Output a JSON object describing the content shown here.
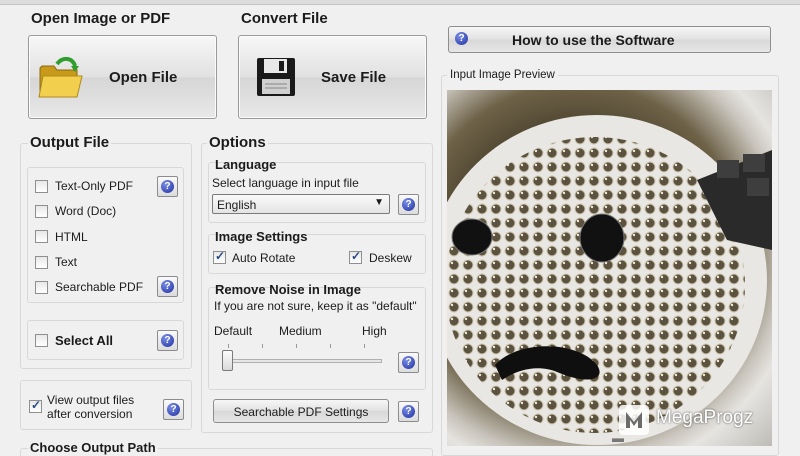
{
  "open_group": {
    "title": "Open Image or PDF",
    "button_label": "Open File"
  },
  "convert_group": {
    "title": "Convert File",
    "button_label": "Save File"
  },
  "how_to_button": {
    "label": "How to use the Software"
  },
  "preview": {
    "title": "Input Image Preview"
  },
  "output_file": {
    "title": "Output File",
    "options": [
      {
        "label": "Text-Only PDF",
        "checked": false
      },
      {
        "label": "Word (Doc)",
        "checked": false
      },
      {
        "label": "HTML",
        "checked": false
      },
      {
        "label": "Text",
        "checked": false
      },
      {
        "label": "Searchable PDF",
        "checked": false
      }
    ],
    "select_all": "Select All"
  },
  "view_output": {
    "line1": "View output files",
    "line2": "after conversion",
    "checked": true
  },
  "choose_path": {
    "title": "Choose Output Path"
  },
  "options": {
    "title": "Options",
    "language": {
      "title": "Language",
      "hint": "Select language in input file",
      "selected": "English"
    },
    "image_settings": {
      "title": "Image Settings",
      "auto_rotate": "Auto Rotate",
      "deskew": "Deskew"
    },
    "noise": {
      "title": "Remove Noise in Image",
      "hint": "If you are not sure, keep it as \"default\"",
      "levels": [
        "Default",
        "Medium",
        "High"
      ],
      "level": "Default"
    },
    "searchable_pdf_button": "Searchable PDF Settings"
  },
  "watermark": {
    "text": "MegaProgz"
  },
  "colors": {
    "accent": "#1e2fa0",
    "panel": "#f0f0f0"
  }
}
